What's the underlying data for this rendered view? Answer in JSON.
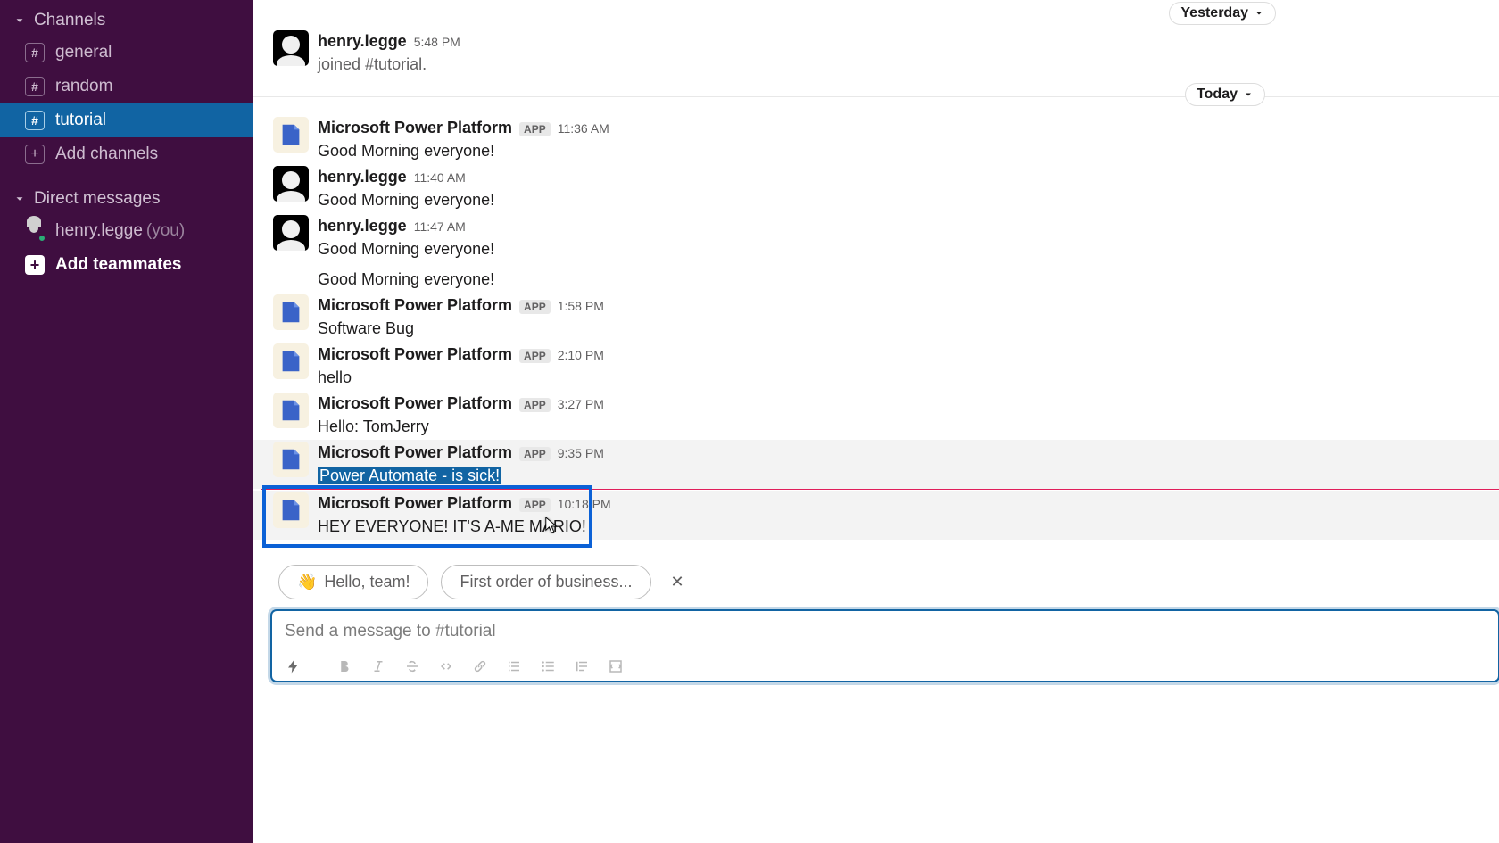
{
  "sidebar": {
    "channels_header": "Channels",
    "channels": [
      {
        "label": "general",
        "active": false
      },
      {
        "label": "random",
        "active": false
      },
      {
        "label": "tutorial",
        "active": true
      }
    ],
    "add_channels": "Add channels",
    "dm_header": "Direct messages",
    "dm_self_name": "henry.legge",
    "dm_self_you": "(you)",
    "add_teammates": "Add teammates"
  },
  "dates": {
    "yesterday": "Yesterday",
    "today": "Today"
  },
  "app_badge": "APP",
  "messages": [
    {
      "author": "henry.legge",
      "time": "5:48 PM",
      "kind": "user",
      "text": "joined #tutorial.",
      "joined": true
    },
    {
      "author": "Microsoft Power Platform",
      "time": "11:36 AM",
      "kind": "app",
      "text": "Good Morning everyone!"
    },
    {
      "author": "henry.legge",
      "time": "11:40 AM",
      "kind": "user",
      "text": "Good Morning everyone!"
    },
    {
      "author": "henry.legge",
      "time": "11:47 AM",
      "kind": "user",
      "text": "Good Morning everyone!",
      "extra": "Good Morning everyone!"
    },
    {
      "author": "Microsoft Power Platform",
      "time": "1:58 PM",
      "kind": "app",
      "text": "Software Bug"
    },
    {
      "author": "Microsoft Power Platform",
      "time": "2:10 PM",
      "kind": "app",
      "text": "hello"
    },
    {
      "author": "Microsoft Power Platform",
      "time": "3:27 PM",
      "kind": "app",
      "text": "Hello: TomJerry"
    },
    {
      "author": "Microsoft Power Platform",
      "time": "9:35 PM",
      "kind": "app",
      "text": "Power Automate - is sick!",
      "selected": true,
      "hover": true
    },
    {
      "author": "Microsoft Power Platform",
      "time": "10:18 PM",
      "kind": "app",
      "text": "HEY EVERYONE! IT'S A-ME MARIO!",
      "highlighted": true
    }
  ],
  "suggestions": {
    "hello": "Hello, team!",
    "first": "First order of business..."
  },
  "composer": {
    "placeholder": "Send a message to #tutorial"
  }
}
